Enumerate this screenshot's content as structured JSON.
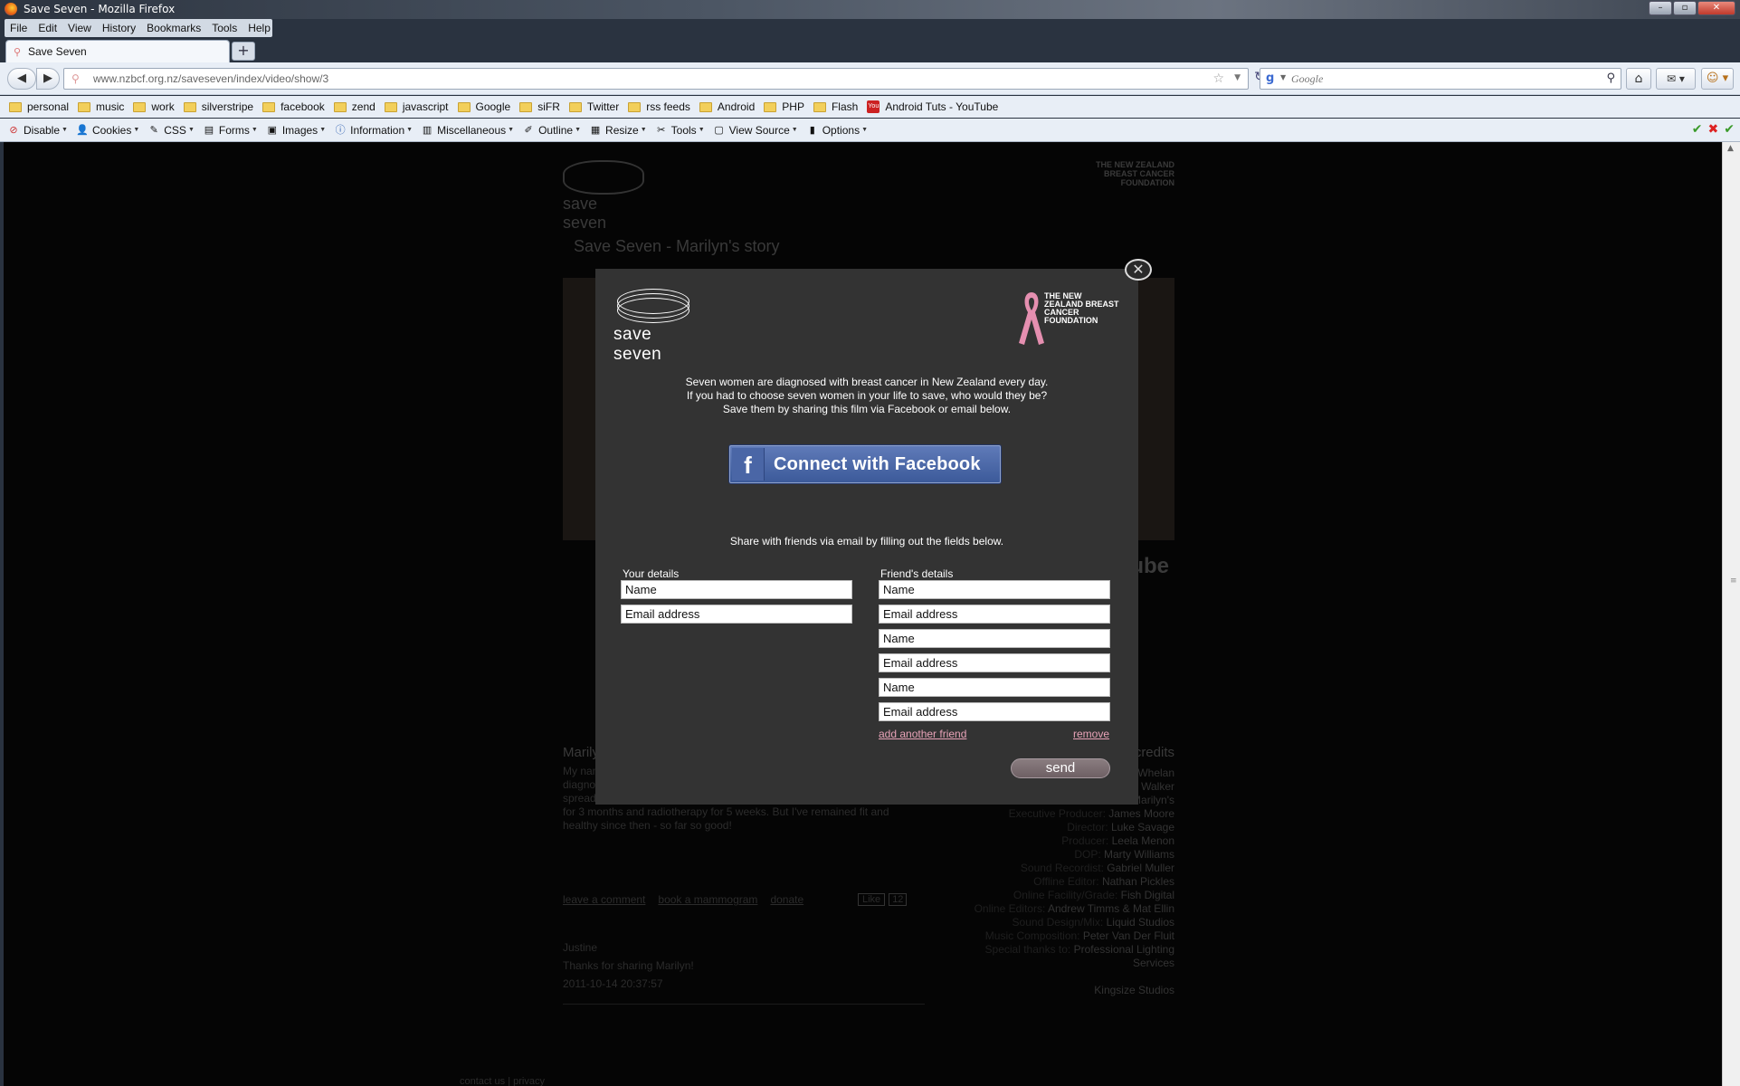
{
  "window": {
    "title": "Save Seven - Mozilla Firefox",
    "controls": [
      "–",
      "▫",
      "✕"
    ]
  },
  "menu": [
    "File",
    "Edit",
    "View",
    "History",
    "Bookmarks",
    "Tools",
    "Help"
  ],
  "tabs": [
    {
      "label": "Save Seven"
    }
  ],
  "navbar": {
    "url": "www.nzbcf.org.nz/saveseven/index/video/show/3",
    "search_placeholder": "Google"
  },
  "bookmarks": [
    {
      "label": "personal",
      "type": "folder"
    },
    {
      "label": "music",
      "type": "folder"
    },
    {
      "label": "work",
      "type": "folder"
    },
    {
      "label": "silverstripe",
      "type": "folder"
    },
    {
      "label": "facebook",
      "type": "folder"
    },
    {
      "label": "zend",
      "type": "folder"
    },
    {
      "label": "javascript",
      "type": "folder"
    },
    {
      "label": "Google",
      "type": "folder"
    },
    {
      "label": "siFR",
      "type": "folder"
    },
    {
      "label": "Twitter",
      "type": "folder"
    },
    {
      "label": "rss feeds",
      "type": "folder"
    },
    {
      "label": "Android",
      "type": "folder"
    },
    {
      "label": "PHP",
      "type": "folder"
    },
    {
      "label": "Flash",
      "type": "folder"
    },
    {
      "label": "Android Tuts - YouTube",
      "type": "youtube"
    }
  ],
  "devbar": [
    {
      "label": "Disable",
      "icon": "disable-icon"
    },
    {
      "label": "Cookies",
      "icon": "cookies-icon"
    },
    {
      "label": "CSS",
      "icon": "css-icon"
    },
    {
      "label": "Forms",
      "icon": "forms-icon"
    },
    {
      "label": "Images",
      "icon": "images-icon"
    },
    {
      "label": "Information",
      "icon": "information-icon"
    },
    {
      "label": "Miscellaneous",
      "icon": "miscellaneous-icon"
    },
    {
      "label": "Outline",
      "icon": "outline-icon"
    },
    {
      "label": "Resize",
      "icon": "resize-icon"
    },
    {
      "label": "Tools",
      "icon": "tools-icon"
    },
    {
      "label": "View Source",
      "icon": "view-source-icon"
    },
    {
      "label": "Options",
      "icon": "options-icon"
    }
  ],
  "page": {
    "logo_text": "save seven",
    "org_name": "THE NEW ZEALAND BREAST CANCER FOUNDATION",
    "story_title": "Save Seven - Marilyn's story",
    "story_heading": "Marilyn",
    "story_body": "My name ... busine... enjoy ... family history of breast cancer but I was diagnosed in April 2010 by my annual mammogram. As the cancer had spread to my lymph nodes, I had a lumpectomy, followed by chemotherapy for 3 months and radiotherapy for 5 weeks. But I've remained fit and healthy since then - so far so good!",
    "links": [
      "leave a comment",
      "book a mammogram",
      "donate"
    ],
    "like_label": "Like",
    "like_count": "12",
    "comment": {
      "author": "Justine",
      "text": "Thanks for sharing Marilyn!",
      "date": "2011-10-14 20:37:57"
    },
    "credits_heading": "credits",
    "credits": [
      {
        "k": "",
        "v": "Whelan"
      },
      {
        "k": "",
        "v": "Walker"
      },
      {
        "k": "",
        "v": "Marilyn's"
      },
      {
        "k": "Executive Producer:",
        "v": "James Moore"
      },
      {
        "k": "Director:",
        "v": "Luke Savage"
      },
      {
        "k": "Producer:",
        "v": "Leela Menon"
      },
      {
        "k": "DOP:",
        "v": "Marty Williams"
      },
      {
        "k": "Sound Recordist:",
        "v": "Gabriel Muller"
      },
      {
        "k": "Offline Editor:",
        "v": "Nathan Pickles"
      },
      {
        "k": "Online Facility/Grade:",
        "v": "Fish Digital"
      },
      {
        "k": "Online Editors:",
        "v": "Andrew Timms & Mat Ellin"
      },
      {
        "k": "Sound Design/Mix:",
        "v": "Liquid Studios"
      },
      {
        "k": "Music Composition:",
        "v": "Peter Van Der Fluit"
      },
      {
        "k": "Special thanks to:",
        "v": "Professional Lighting Services"
      },
      {
        "k": "",
        "v": ""
      },
      {
        "k": "",
        "v": "Kingsize Studios"
      }
    ],
    "footer": "contact us | privacy"
  },
  "modal": {
    "close": "✕",
    "logo_text": "save seven",
    "org_name": "THE NEW ZEALAND BREAST CANCER FOUNDATION",
    "intro_1": "Seven women are diagnosed with breast cancer in New Zealand every day.",
    "intro_2": "If you had to choose seven women in your life to save, who would they be?",
    "intro_3": "Save them by sharing this film via Facebook or email below.",
    "fb_label": "Connect with Facebook",
    "share_text": "Share with friends via email by filling out the fields below.",
    "your_label": "Your details",
    "friend_label": "Friend's details",
    "your_fields": [
      "Name",
      "Email address"
    ],
    "friend_fields": [
      "Name",
      "Email address",
      "Name",
      "Email address",
      "Name",
      "Email address"
    ],
    "add_friend": "add another friend",
    "remove": "remove",
    "send": "send"
  },
  "colors": {
    "accent_pink": "#e8a3b8",
    "facebook_blue": "#3c5a9a",
    "modal_bg": "#333333"
  }
}
